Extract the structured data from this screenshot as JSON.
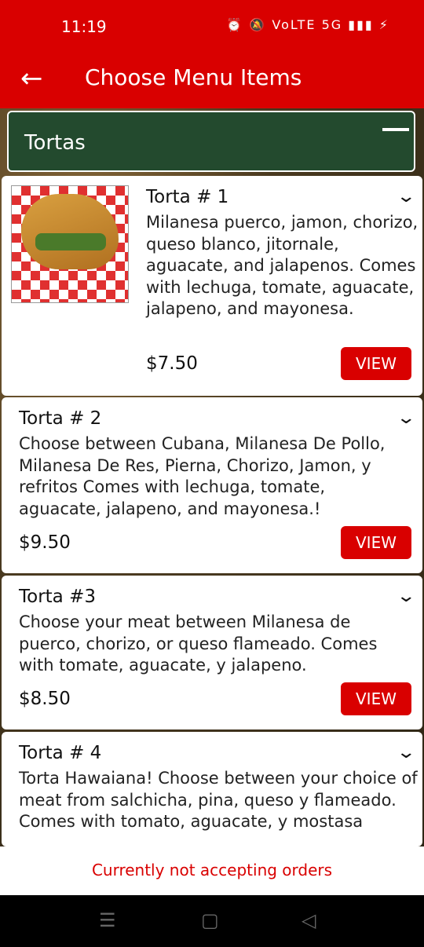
{
  "status": {
    "time": "11:19",
    "icons": "⏰ 🔕 VoLTE 5G ▮▮▮ ⚡"
  },
  "appbar": {
    "title": "Choose Menu Items",
    "back_icon": "arrow-left-icon"
  },
  "category": {
    "title": "Tortas"
  },
  "items": [
    {
      "name": "Torta # 1",
      "desc": "Milanesa puerco, jamon, chorizo, queso blanco, jitornale, aguacate, and jalapenos. Comes with lechuga, tomate, aguacate, jalapeno, and mayonesa.",
      "price": "$7.50",
      "view": "VIEW"
    },
    {
      "name": "Torta # 2",
      "desc": "Choose between Cubana, Milanesa De Pollo, Milanesa De Res, Pierna, Chorizo, Jamon, y refritos Comes with lechuga, tomate, aguacate, jalapeno, and mayonesa.!",
      "price": "$9.50",
      "view": "VIEW"
    },
    {
      "name": "Torta #3",
      "desc": "Choose your meat between Milanesa de puerco, chorizo, or queso flameado. Comes with tomate, aguacate, y jalapeno.",
      "price": "$8.50",
      "view": "VIEW"
    },
    {
      "name": "Torta # 4",
      "desc": "Torta Hawaiana! Choose between your choice of meat from salchicha, pina, queso  y flameado. Comes with tomato, aguacate, y mostasa",
      "price": "",
      "view": ""
    }
  ],
  "footer": {
    "message": "Currently not accepting orders"
  }
}
